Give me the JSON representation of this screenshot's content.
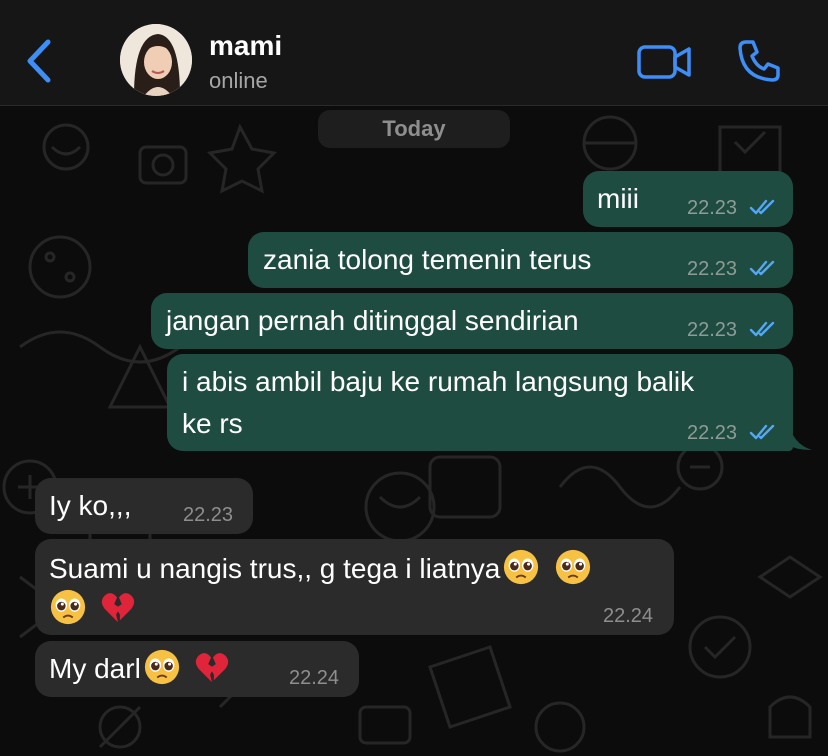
{
  "header": {
    "contact_name": "mami",
    "contact_status": "online"
  },
  "chat": {
    "date_label": "Today",
    "messages": [
      {
        "direction": "outgoing",
        "text": "miii",
        "time": "22.23",
        "read": true
      },
      {
        "direction": "outgoing",
        "text": "zania tolong temenin terus",
        "time": "22.23",
        "read": true
      },
      {
        "direction": "outgoing",
        "text": "jangan pernah ditinggal sendirian",
        "time": "22.23",
        "read": true
      },
      {
        "direction": "outgoing",
        "text_line1": "i abis ambil baju ke rumah langsung balik",
        "text_line2": "ke rs",
        "time": "22.23",
        "read": true
      },
      {
        "direction": "incoming",
        "text": "Iy ko,,,",
        "time": "22.23"
      },
      {
        "direction": "incoming",
        "text_line1": "Suami u nangis trus,, g tega i liatnya",
        "time": "22.24",
        "emojis": [
          "pleading-face",
          "pleading-face",
          "pleading-face",
          "broken-heart"
        ]
      },
      {
        "direction": "incoming",
        "text": "My darl",
        "time": "22.24",
        "emojis": [
          "pleading-face",
          "broken-heart"
        ]
      }
    ]
  },
  "colors": {
    "accent": "#3e8ef7",
    "outgoing_bubble": "#1f4c41",
    "incoming_bubble": "#2b2b2c",
    "read_tick": "#53a7f5"
  }
}
